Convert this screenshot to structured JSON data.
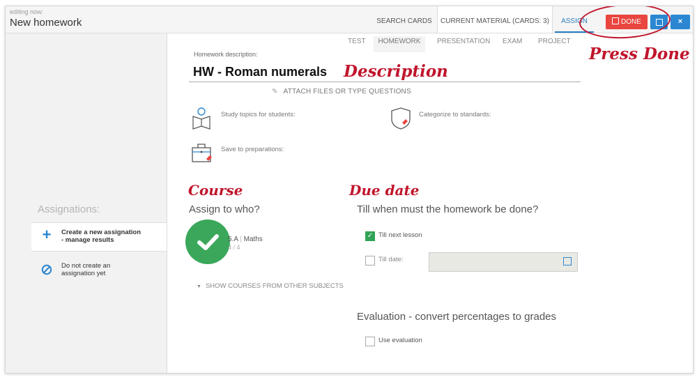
{
  "header": {
    "editing_label": "editing now:",
    "title": "New homework",
    "tabs": [
      "SEARCH CARDS",
      "CURRENT MATERIAL (CARDS: 3)",
      "ASSIGN"
    ],
    "done_label": "DONE",
    "save_icon": "save-icon",
    "close_label": "×"
  },
  "annotations": {
    "press_done": "Press Done",
    "description": "Description",
    "course": "Course",
    "due_date": "Due date"
  },
  "subtabs": [
    "TEST",
    "HOMEWORK",
    "PRESENTATION",
    "EXAM",
    "PROJECT"
  ],
  "homework": {
    "description_label": "Homework description:",
    "description_value": "HW - Roman numerals",
    "attach_label": "ATTACH FILES OR TYPE QUESTIONS",
    "study_topics": "Study topics for students:",
    "categorize": "Categorize to standards:",
    "save_preparations": "Save to preparations:"
  },
  "sidebar": {
    "title": "Assignations:",
    "options": [
      {
        "line1": "Create a new assignation",
        "line2": "- manage results",
        "icon": "plus-icon"
      },
      {
        "line1": "Do not create an",
        "line2": "assignation yet",
        "icon": "forbidden-icon"
      }
    ]
  },
  "assign": {
    "title": "Assign to who?",
    "course_class": "5.A",
    "course_subject": "Maths",
    "course_count": "4 / 4",
    "show_other": "SHOW COURSES FROM OTHER SUBJECTS"
  },
  "due": {
    "title": "Till when must the homework be done?",
    "next_lesson": "Till next lesson",
    "till_date": "Till date:",
    "next_lesson_checked": true,
    "till_date_checked": false
  },
  "evaluation": {
    "title": "Evaluation - convert percentages to grades",
    "use_label": "Use evaluation",
    "checked": false
  },
  "colors": {
    "accent": "#2b87d1",
    "done": "#e8463f",
    "green": "#3aa75a",
    "annotation": "#c0152c"
  }
}
